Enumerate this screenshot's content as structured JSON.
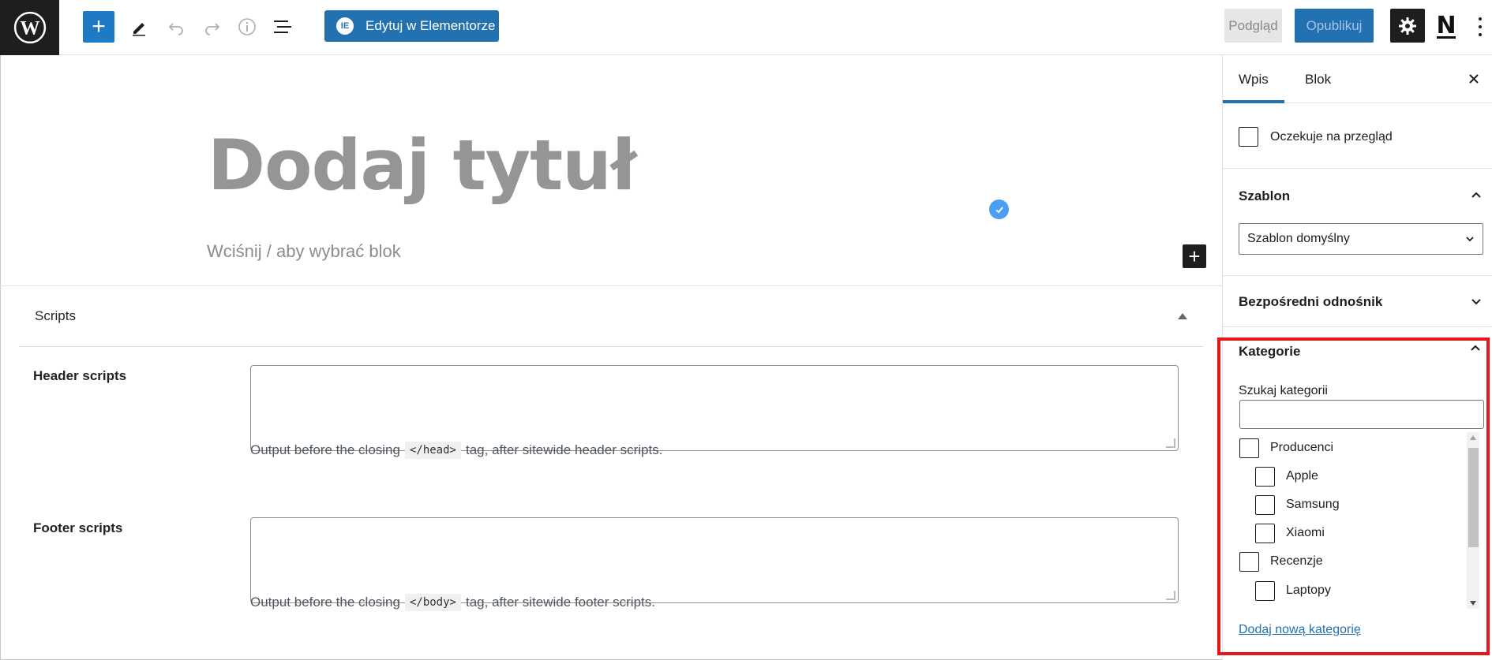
{
  "toolbar": {
    "elementor_label": "Edytuj w Elementorze",
    "preview_label": "Podgląd",
    "publish_label": "Opublikuj"
  },
  "editor": {
    "title_placeholder": "Dodaj tytuł",
    "block_placeholder": "Wciśnij / aby wybrać blok"
  },
  "scripts_metabox": {
    "title": "Scripts",
    "header_label": "Header scripts",
    "header_help_before": "Output before the closing",
    "header_help_code": "</head>",
    "header_help_after": "tag, after sitewide header scripts.",
    "footer_label": "Footer scripts",
    "footer_help_before": "Output before the closing",
    "footer_help_code": "</body>",
    "footer_help_after": "tag, after sitewide footer scripts."
  },
  "sidebar": {
    "tabs": [
      {
        "label": "Wpis",
        "active": true
      },
      {
        "label": "Blok",
        "active": false
      }
    ],
    "pending_review_label": "Oczekuje na przegląd",
    "template_panel": {
      "title": "Szablon",
      "selected": "Szablon domyślny"
    },
    "permalink_panel": {
      "title": "Bezpośredni odnośnik"
    },
    "categories_panel": {
      "title": "Kategorie",
      "search_label": "Szukaj kategorii",
      "items": [
        {
          "label": "Producenci",
          "level": 0,
          "checked": false
        },
        {
          "label": "Apple",
          "level": 1,
          "checked": false
        },
        {
          "label": "Samsung",
          "level": 1,
          "checked": false
        },
        {
          "label": "Xiaomi",
          "level": 1,
          "checked": false
        },
        {
          "label": "Recenzje",
          "level": 0,
          "checked": false
        },
        {
          "label": "Laptopy",
          "level": 1,
          "checked": false
        }
      ],
      "add_new_label": "Dodaj nową kategorię"
    }
  },
  "colors": {
    "accent": "#2271b1",
    "highlight_border": "#e8151b",
    "check_badge": "#4a9ff5"
  }
}
